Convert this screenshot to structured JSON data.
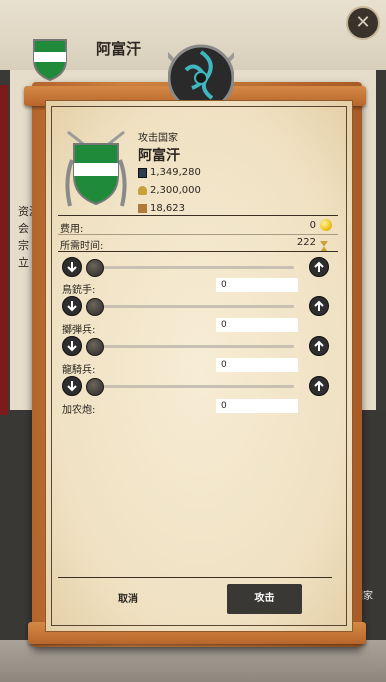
{
  "background": {
    "title": "阿富汗",
    "side_texts": [
      "资源",
      "会",
      "宗",
      "立"
    ],
    "right_label": "国家"
  },
  "dialog": {
    "subtitle": "攻击国家",
    "country_name": "阿富汗",
    "stats": {
      "money": "1,349,280",
      "population": "2,300,000",
      "army": "18,623"
    },
    "cost_label": "费用:",
    "cost_value": "0",
    "time_label": "所需时间:",
    "time_value": "222",
    "units": [
      {
        "name": "鳥銃手:",
        "value": "0"
      },
      {
        "name": "擲弾兵:",
        "value": "0"
      },
      {
        "name": "龍騎兵:",
        "value": "0"
      },
      {
        "name": "加农炮:",
        "value": "0"
      }
    ],
    "cancel_label": "取消",
    "attack_label": "攻击"
  },
  "icons": {
    "close": "close-icon",
    "decrease": "arrow-down-icon",
    "increase": "arrow-up-icon",
    "coin": "coin-icon",
    "hourglass": "hourglass-icon"
  },
  "colors": {
    "flag_green": "#1f8a3a",
    "flag_white": "#ffffff",
    "button_dark": "#3a3835",
    "parchment": "#f2e6cc",
    "wood": "#c27434"
  }
}
